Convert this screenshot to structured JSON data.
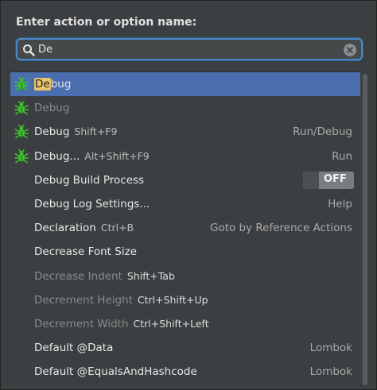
{
  "header": {
    "title": "Enter action or option name:"
  },
  "search": {
    "value": "De"
  },
  "items": [
    {
      "pre": "",
      "hl": "De",
      "post": "bug",
      "shortcut": "",
      "group": "",
      "icon": "bug-icon",
      "selected": true,
      "dim": false
    },
    {
      "pre": "Debug",
      "hl": "",
      "post": "",
      "shortcut": "",
      "group": "",
      "icon": "bug-icon",
      "selected": false,
      "dim": true
    },
    {
      "pre": "Debug",
      "hl": "",
      "post": "",
      "shortcut": "Shift+F9",
      "group": "Run/Debug",
      "icon": "bug-icon",
      "selected": false,
      "dim": false
    },
    {
      "pre": "Debug...",
      "hl": "",
      "post": "",
      "shortcut": "Alt+Shift+F9",
      "group": "Run",
      "icon": "bug-icon",
      "selected": false,
      "dim": false
    },
    {
      "pre": "Debug Build Process",
      "hl": "",
      "post": "",
      "shortcut": "",
      "group": "",
      "icon": "",
      "toggle": "OFF",
      "selected": false,
      "dim": false
    },
    {
      "pre": "Debug Log Settings...",
      "hl": "",
      "post": "",
      "shortcut": "",
      "group": "Help",
      "icon": "",
      "selected": false,
      "dim": false
    },
    {
      "pre": "Declaration",
      "hl": "",
      "post": "",
      "shortcut": "Ctrl+B",
      "group": "Goto by Reference Actions",
      "icon": "",
      "selected": false,
      "dim": false
    },
    {
      "pre": "Decrease Font Size",
      "hl": "",
      "post": "",
      "shortcut": "",
      "group": "",
      "icon": "",
      "selected": false,
      "dim": false
    },
    {
      "pre": "Decrease Indent",
      "hl": "",
      "post": "",
      "shortcut": "Shift+Tab",
      "group": "",
      "icon": "",
      "selected": false,
      "dim": true
    },
    {
      "pre": "Decrement Height",
      "hl": "",
      "post": "",
      "shortcut": "Ctrl+Shift+Up",
      "group": "",
      "icon": "",
      "selected": false,
      "dim": true
    },
    {
      "pre": "Decrement Width",
      "hl": "",
      "post": "",
      "shortcut": "Ctrl+Shift+Left",
      "group": "",
      "icon": "",
      "selected": false,
      "dim": true
    },
    {
      "pre": "Default @Data",
      "hl": "",
      "post": "",
      "shortcut": "",
      "group": "Lombok",
      "icon": "",
      "selected": false,
      "dim": false
    },
    {
      "pre": "Default @EqualsAndHashcode",
      "hl": "",
      "post": "",
      "shortcut": "",
      "group": "Lombok",
      "icon": "",
      "selected": false,
      "dim": false
    }
  ],
  "colors": {
    "selection": "#4b6eaf",
    "highlight": "#e8c46a",
    "background": "#3c3f41",
    "focus_ring": "#4a88c7"
  }
}
